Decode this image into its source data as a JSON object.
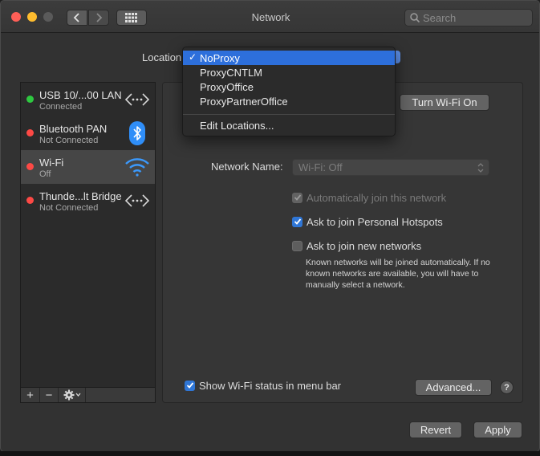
{
  "window": {
    "title": "Network"
  },
  "search": {
    "placeholder": "Search"
  },
  "location": {
    "label": "Location:",
    "menu_items": [
      "NoProxy",
      "ProxyCNTLM",
      "ProxyOffice",
      "ProxyPartnerOffice"
    ],
    "selected": "NoProxy",
    "edit_label": "Edit Locations..."
  },
  "services": [
    {
      "name": "USB 10/...00 LAN",
      "status": "Connected",
      "state": "green",
      "icon": "ethernet-icon"
    },
    {
      "name": "Bluetooth PAN",
      "status": "Not Connected",
      "state": "red",
      "icon": "bluetooth-icon"
    },
    {
      "name": "Wi-Fi",
      "status": "Off",
      "state": "red",
      "icon": "wifi-icon",
      "selected": true
    },
    {
      "name": "Thunde...lt Bridge",
      "status": "Not Connected",
      "state": "red",
      "icon": "ethernet-icon"
    }
  ],
  "sidebar_tools": {
    "add": "+",
    "remove": "−"
  },
  "wifi": {
    "turn_on_label": "Turn Wi-Fi On",
    "network_name_label": "Network Name:",
    "network_name_value": "Wi-Fi: Off",
    "auto_join_label": "Automatically join this network",
    "auto_join_checked": true,
    "auto_join_enabled": false,
    "hotspots_label": "Ask to join Personal Hotspots",
    "hotspots_checked": true,
    "new_networks_label": "Ask to join new networks",
    "new_networks_checked": false,
    "note": "Known networks will be joined automatically. If no known networks are available, you will have to manually select a network.",
    "show_status_label": "Show Wi-Fi status in menu bar",
    "show_status_checked": true
  },
  "buttons": {
    "advanced": "Advanced...",
    "help": "?",
    "revert": "Revert",
    "apply": "Apply"
  },
  "colors": {
    "accent": "#2d6fdb",
    "status_green": "#2ec840",
    "status_red": "#fd4945",
    "wifi_icon": "#3b99fc",
    "bluetooth_icon": "#2f8ef8"
  }
}
